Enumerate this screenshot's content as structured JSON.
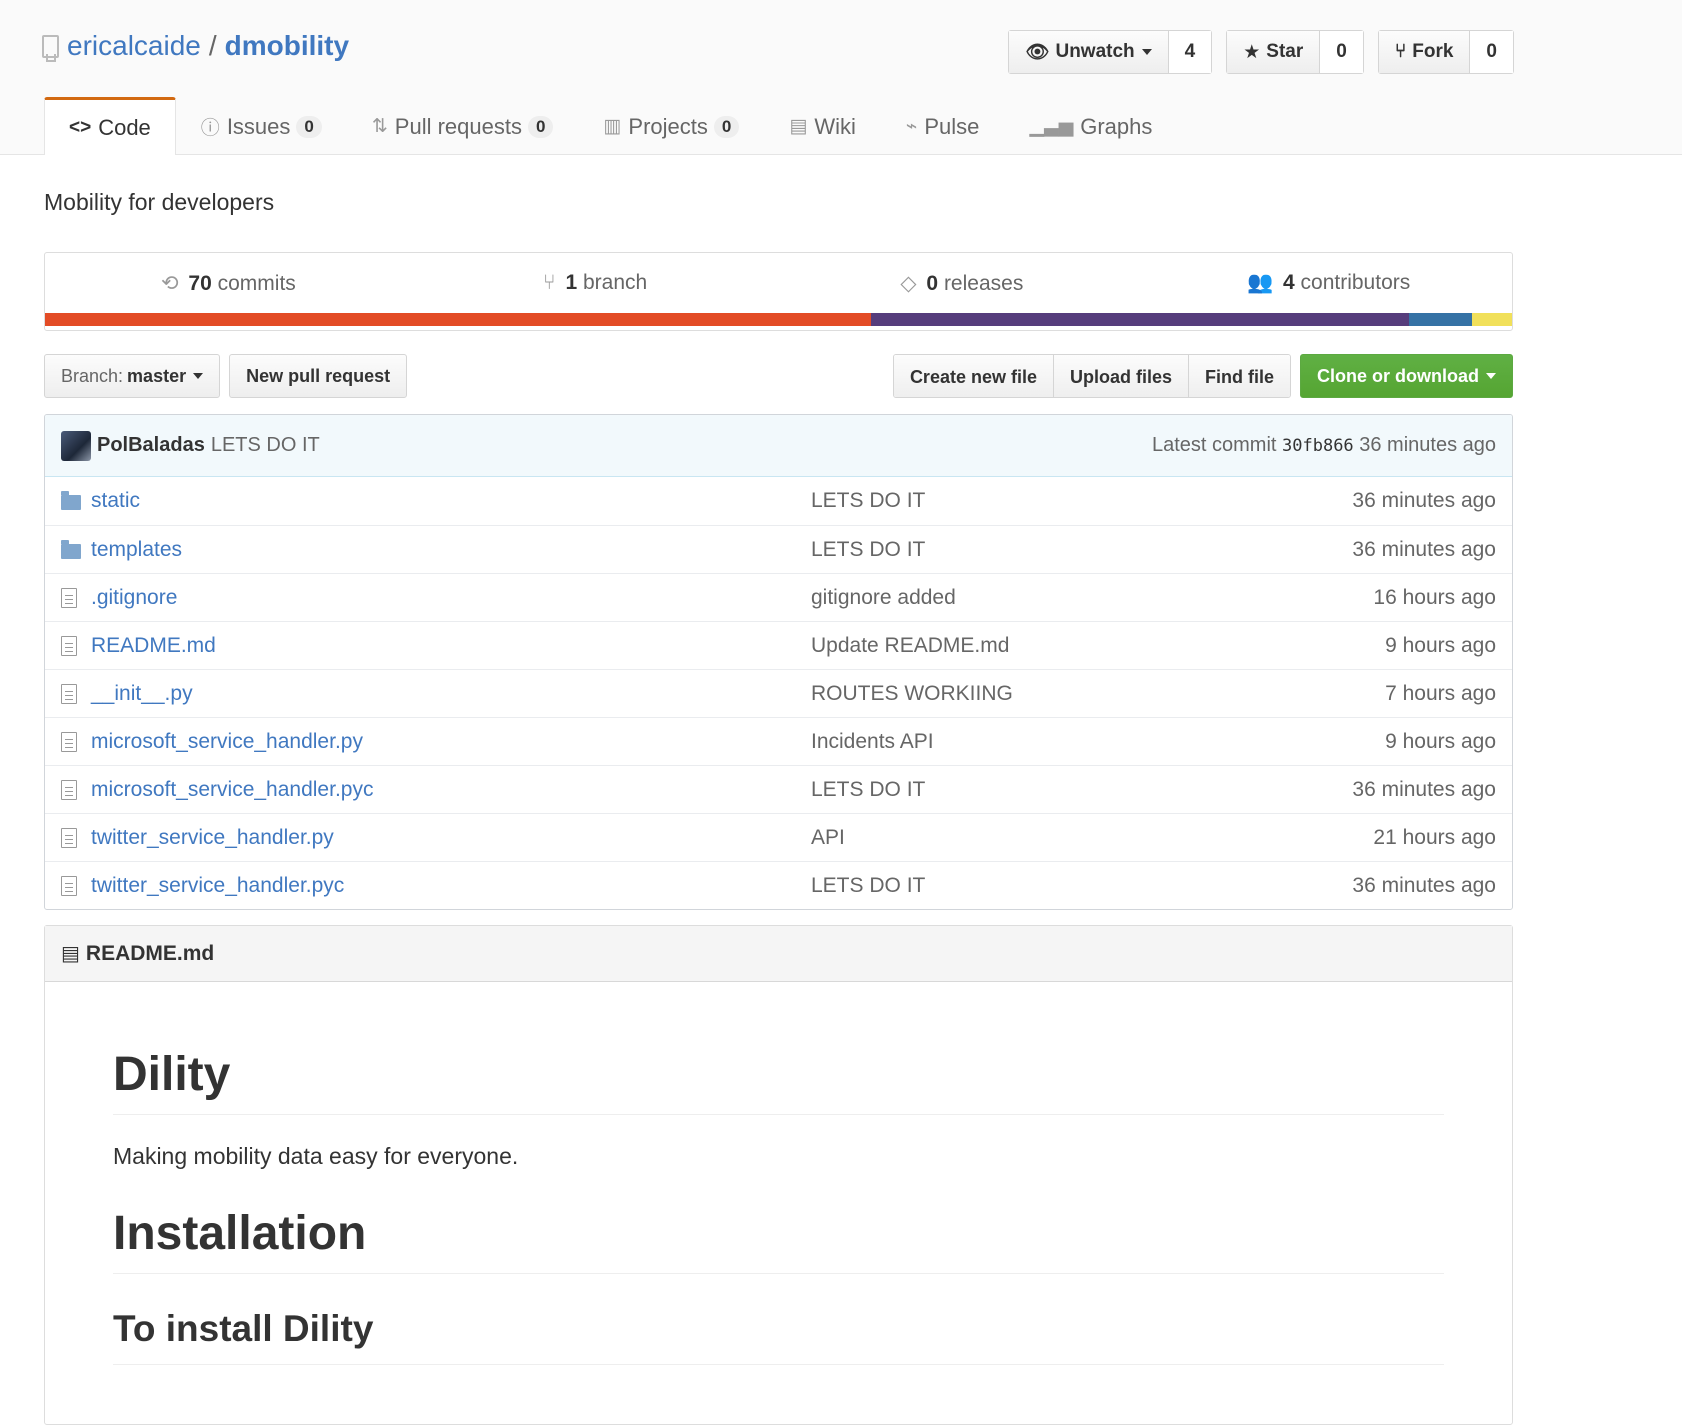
{
  "repo": {
    "owner": "ericalcaide",
    "separator": "/",
    "name": "dmobility"
  },
  "actions": {
    "watch": {
      "label": "Unwatch",
      "count": "4"
    },
    "star": {
      "label": "Star",
      "count": "0"
    },
    "fork": {
      "label": "Fork",
      "count": "0"
    }
  },
  "tabs": [
    {
      "label": "Code",
      "icon": "<>",
      "selected": true
    },
    {
      "label": "Issues",
      "counter": "0"
    },
    {
      "label": "Pull requests",
      "counter": "0"
    },
    {
      "label": "Projects",
      "counter": "0"
    },
    {
      "label": "Wiki"
    },
    {
      "label": "Pulse"
    },
    {
      "label": "Graphs"
    }
  ],
  "description": "Mobility for developers",
  "summary": {
    "commits": {
      "count": "70",
      "label": "commits"
    },
    "branches": {
      "count": "1",
      "label": "branch"
    },
    "releases": {
      "count": "0",
      "label": "releases"
    },
    "contributors": {
      "count": "4",
      "label": "contributors"
    }
  },
  "languages": [
    {
      "color": "#e34c26",
      "percent": 56.3
    },
    {
      "color": "#563d7c",
      "percent": 36.7
    },
    {
      "color": "#3572A5",
      "percent": 4.3
    },
    {
      "color": "#f1e05a",
      "percent": 2.7
    }
  ],
  "filenav": {
    "branch_prefix": "Branch:",
    "branch_name": "master",
    "new_pr": "New pull request",
    "create_file": "Create new file",
    "upload_files": "Upload files",
    "find_file": "Find file",
    "clone": "Clone or download"
  },
  "commit_tease": {
    "author": "PolBaladas",
    "message": "LETS DO IT",
    "latest_label": "Latest commit",
    "sha": "30fb866",
    "age": "36 minutes ago"
  },
  "files": [
    {
      "type": "dir",
      "name": "static",
      "message": "LETS DO IT",
      "age": "36 minutes ago"
    },
    {
      "type": "dir",
      "name": "templates",
      "message": "LETS DO IT",
      "age": "36 minutes ago"
    },
    {
      "type": "file",
      "name": ".gitignore",
      "message": "gitignore added",
      "age": "16 hours ago"
    },
    {
      "type": "file",
      "name": "README.md",
      "message": "Update README.md",
      "age": "9 hours ago"
    },
    {
      "type": "file",
      "name": "__init__.py",
      "message": "ROUTES WORKIING",
      "age": "7 hours ago"
    },
    {
      "type": "file",
      "name": "microsoft_service_handler.py",
      "message": "Incidents API",
      "age": "9 hours ago"
    },
    {
      "type": "file",
      "name": "microsoft_service_handler.pyc",
      "message": "LETS DO IT",
      "age": "36 minutes ago"
    },
    {
      "type": "file",
      "name": "twitter_service_handler.py",
      "message": "API",
      "age": "21 hours ago"
    },
    {
      "type": "file",
      "name": "twitter_service_handler.pyc",
      "message": "LETS DO IT",
      "age": "36 minutes ago"
    }
  ],
  "readme": {
    "title": "README.md",
    "h1": "Dility",
    "intro": "Making mobility data easy for everyone.",
    "h1_install": "Installation",
    "h2_install": "To install Dility"
  }
}
